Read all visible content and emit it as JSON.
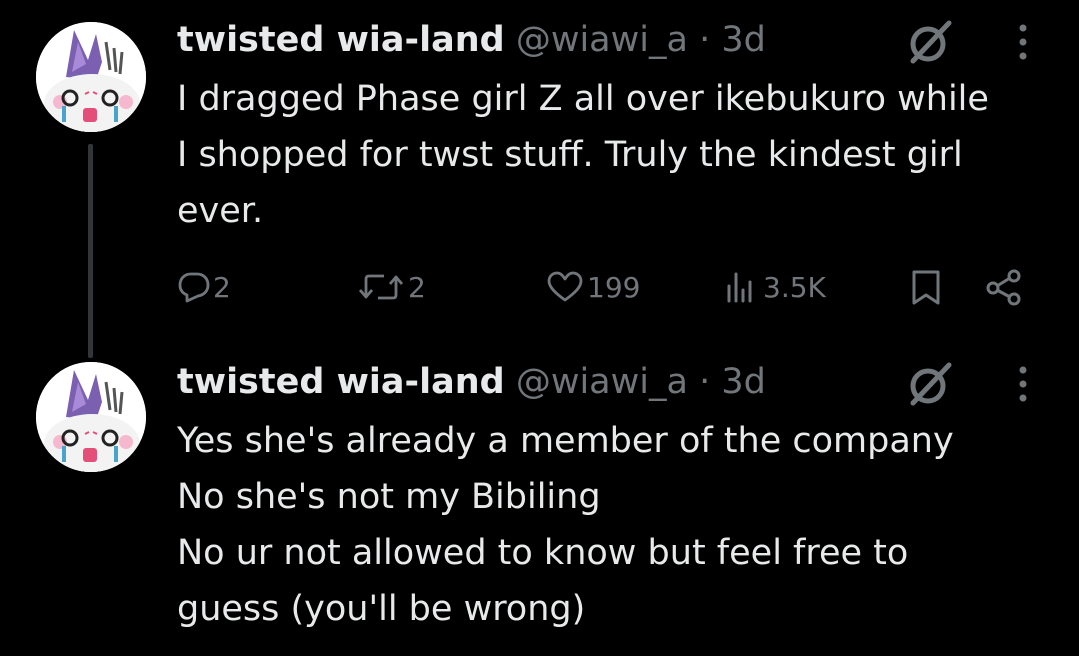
{
  "tweets": [
    {
      "author_name": "twisted wia-land",
      "handle": "@wiawi_a",
      "separator": "·",
      "time": "3d",
      "text_lines": [
        "I dragged Phase girl Z all over ikebukuro while",
        "I shopped for twst stuff. Truly the kindest girl",
        "ever."
      ],
      "stats": {
        "replies": "2",
        "reposts": "2",
        "likes": "199",
        "views": "3.5K"
      }
    },
    {
      "author_name": "twisted wia-land",
      "handle": "@wiawi_a",
      "separator": "·",
      "time": "3d",
      "text_lines": [
        "Yes she's already a member of the company",
        "No she's not my Bibiling",
        "No ur not allowed to know but feel free to",
        "guess (you'll be wrong)"
      ]
    }
  ],
  "icons": {
    "grok": "grok-icon",
    "more": "more-dots-icon",
    "reply": "reply-icon",
    "repost": "repost-icon",
    "like": "heart-icon",
    "views": "views-chart-icon",
    "bookmark": "bookmark-icon",
    "share": "share-icon"
  },
  "colors": {
    "background": "#000000",
    "primary_text": "#e7e9ea",
    "secondary_text": "#71767b",
    "thread_line": "#333639"
  }
}
